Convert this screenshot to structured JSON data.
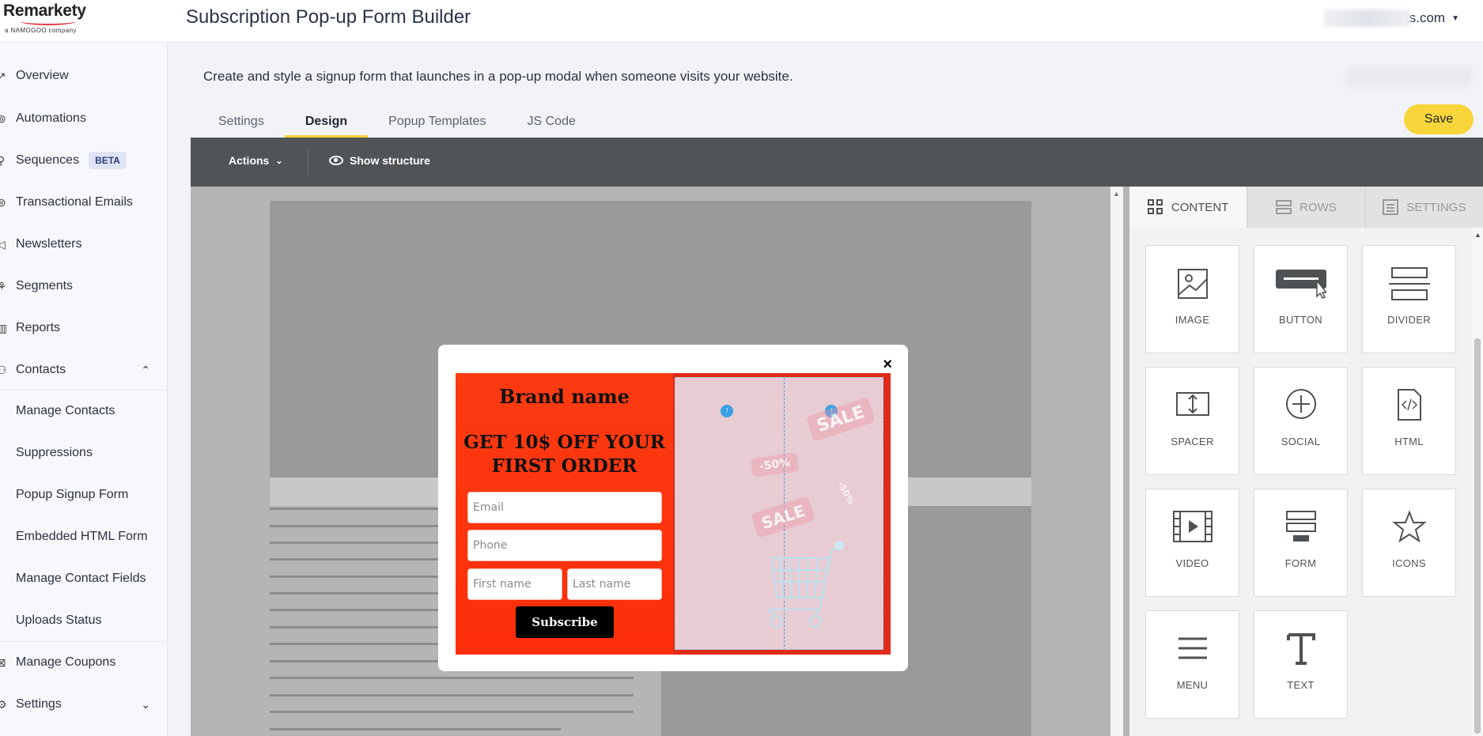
{
  "app": {
    "logo_text": "Remarkety",
    "logo_sub": "a NAMOGOO company",
    "page_title": "Subscription Pop-up Form Builder",
    "account_suffix": "ts.com"
  },
  "sidebar": {
    "items": [
      {
        "label": "Overview",
        "icon": "trend-icon"
      },
      {
        "label": "Automations",
        "icon": "automation-icon"
      },
      {
        "label": "Sequences",
        "icon": "pin-icon",
        "badge": "BETA"
      },
      {
        "label": "Transactional Emails",
        "icon": "mail-icon"
      },
      {
        "label": "Newsletters",
        "icon": "send-icon"
      },
      {
        "label": "Segments",
        "icon": "segments-icon"
      },
      {
        "label": "Reports",
        "icon": "chart-icon"
      },
      {
        "label": "Contacts",
        "icon": "people-icon"
      }
    ],
    "contacts_sub": [
      {
        "label": "Manage Contacts"
      },
      {
        "label": "Suppressions"
      },
      {
        "label": "Popup Signup Form"
      },
      {
        "label": "Embedded HTML Form"
      },
      {
        "label": "Manage Contact Fields"
      },
      {
        "label": "Uploads Status"
      }
    ],
    "bottom_items": [
      {
        "label": "Manage Coupons",
        "icon": "coupon-icon"
      },
      {
        "label": "Settings",
        "icon": "gear-icon"
      }
    ]
  },
  "main": {
    "subtitle": "Create and style a signup form that launches in a pop-up modal when someone visits your website.",
    "tabs": [
      {
        "label": "Settings",
        "active": false
      },
      {
        "label": "Design",
        "active": true
      },
      {
        "label": "Popup Templates",
        "active": false
      },
      {
        "label": "JS Code",
        "active": false
      }
    ],
    "save_label": "Save"
  },
  "editor": {
    "actions_label": "Actions",
    "show_structure_label": "Show structure",
    "popup": {
      "close": "×",
      "brand": "Brand name",
      "offer_line1": "GET 10$ OFF YOUR",
      "offer_line2": "FIRST ORDER",
      "email_placeholder": "Email",
      "phone_placeholder": "Phone",
      "first_name_placeholder": "First name",
      "last_name_placeholder": "Last name",
      "subscribe_label": "Subscribe",
      "sale_1": "SALE",
      "sale_2": "SALE",
      "discount_1": "-50%",
      "discount_2": "-50%"
    }
  },
  "panel": {
    "tabs": [
      {
        "label": "CONTENT",
        "active": true
      },
      {
        "label": "ROWS",
        "active": false
      },
      {
        "label": "SETTINGS",
        "active": false
      }
    ],
    "tiles": [
      {
        "label": "IMAGE",
        "icon": "image-icon"
      },
      {
        "label": "BUTTON",
        "icon": "button-icon"
      },
      {
        "label": "DIVIDER",
        "icon": "divider-icon"
      },
      {
        "label": "SPACER",
        "icon": "spacer-icon"
      },
      {
        "label": "SOCIAL",
        "icon": "social-icon"
      },
      {
        "label": "HTML",
        "icon": "html-icon"
      },
      {
        "label": "VIDEO",
        "icon": "video-icon"
      },
      {
        "label": "FORM",
        "icon": "form-icon"
      },
      {
        "label": "ICONS",
        "icon": "star-icon"
      },
      {
        "label": "MENU",
        "icon": "menu-icon"
      },
      {
        "label": "TEXT",
        "icon": "text-icon"
      }
    ]
  },
  "colors": {
    "accent_yellow": "#f8d53a",
    "toolbar_dark": "#505456",
    "popup_red": "#fb3b12"
  }
}
